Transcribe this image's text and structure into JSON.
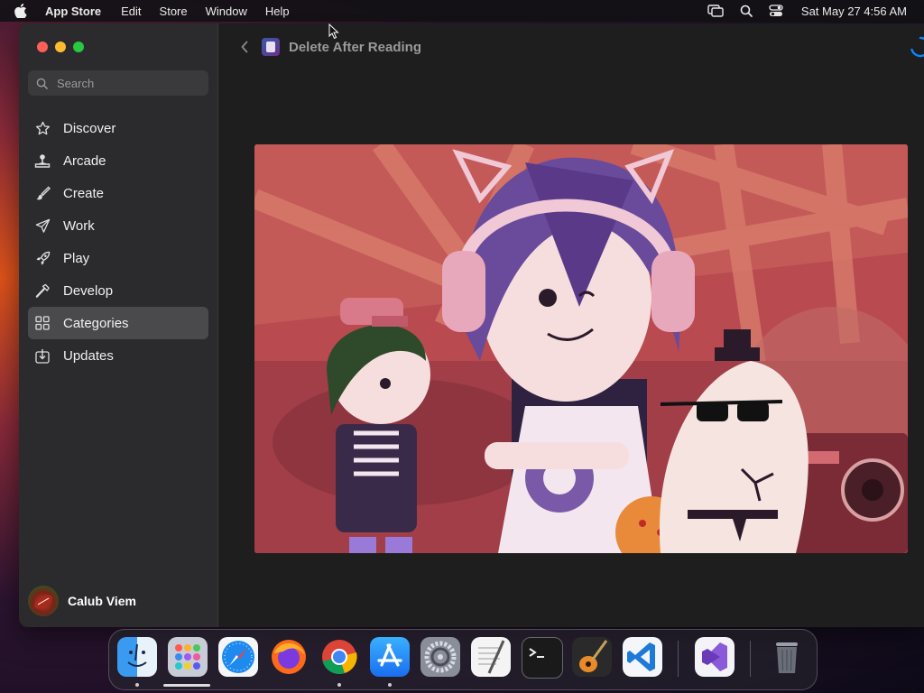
{
  "menubar": {
    "app_name": "App Store",
    "items": [
      "Edit",
      "Store",
      "Window",
      "Help"
    ],
    "clock": "Sat May 27  4:56 AM",
    "status_icons": [
      "screen-mirroring-icon",
      "spotlight-search-icon",
      "control-center-icon"
    ]
  },
  "sidebar": {
    "search_placeholder": "Search",
    "items": [
      {
        "label": "Discover",
        "icon": "star-icon"
      },
      {
        "label": "Arcade",
        "icon": "joystick-icon"
      },
      {
        "label": "Create",
        "icon": "paintbrush-icon"
      },
      {
        "label": "Work",
        "icon": "paperplane-icon"
      },
      {
        "label": "Play",
        "icon": "rocket-icon"
      },
      {
        "label": "Develop",
        "icon": "hammer-icon"
      },
      {
        "label": "Categories",
        "icon": "grid-icon",
        "active": true
      },
      {
        "label": "Updates",
        "icon": "download-icon"
      }
    ],
    "user_name": "Calub Viem"
  },
  "main": {
    "app_title": "Delete After Reading",
    "artwork": "game-artwork-image"
  },
  "dock": {
    "apps": [
      "Finder",
      "Launchpad",
      "Safari",
      "Firefox",
      "Google Chrome",
      "App Store",
      "System Settings",
      "TextEdit",
      "Terminal",
      "GarageBand",
      "Visual Studio Code",
      "Visual Studio",
      "Trash"
    ]
  },
  "colors": {
    "accent": "#0a84ff",
    "sidebar_bg": "#2b2b2d",
    "main_bg": "#1e1e1e",
    "active_item_bg": "#4a4a4d"
  }
}
